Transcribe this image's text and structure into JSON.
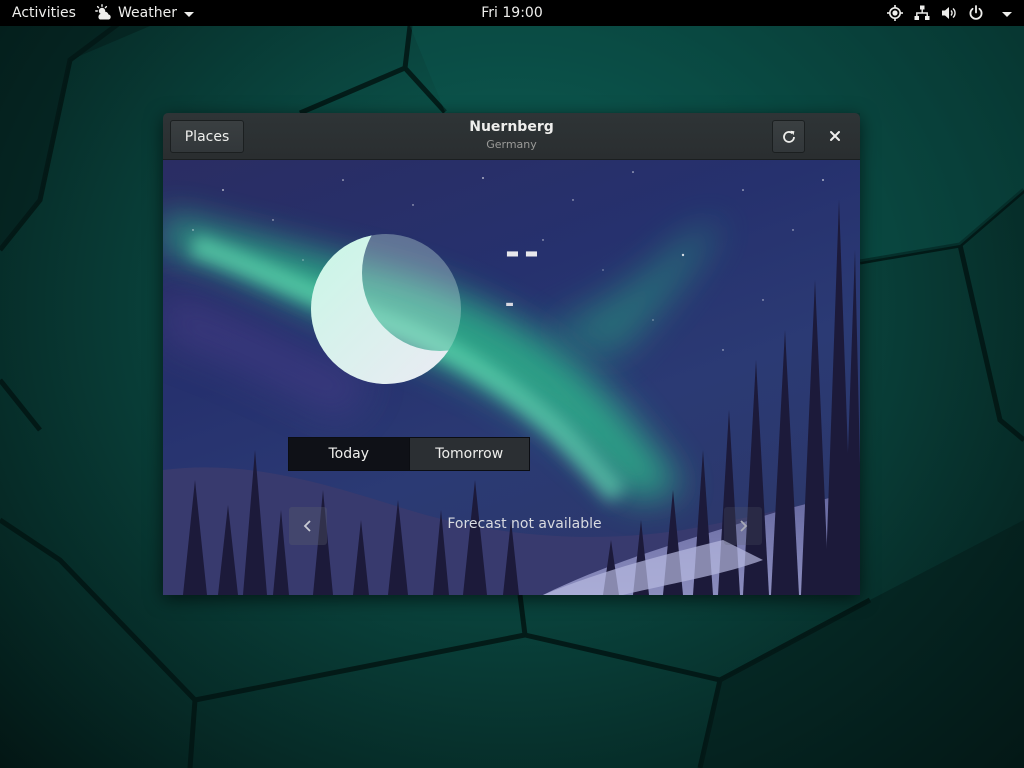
{
  "topbar": {
    "activities": "Activities",
    "app_name": "Weather",
    "clock": "Fri 19:00",
    "icons": [
      "weather-app-icon",
      "location-icon",
      "network-icon",
      "volume-icon",
      "power-icon",
      "system-menu-arrow-icon"
    ]
  },
  "window": {
    "title": "Nuernberg",
    "subtitle": "Germany",
    "places_label": "Places",
    "refresh_icon": "refresh-icon",
    "close_icon": "close-icon"
  },
  "weather": {
    "temperature": "--",
    "condition": "-",
    "icon": "moon-icon"
  },
  "tabs": [
    {
      "label": "Today",
      "active": true
    },
    {
      "label": "Tomorrow",
      "active": false
    }
  ],
  "forecast": {
    "message": "Forecast not available",
    "prev_icon": "chevron-left-icon",
    "next_icon": "chevron-right-icon"
  },
  "colors": {
    "topbar_bg": "#000000",
    "headerbar_bg": "#2e3436",
    "active_tab_bg": "#0f1117",
    "aurora": "#3fe0a0"
  }
}
